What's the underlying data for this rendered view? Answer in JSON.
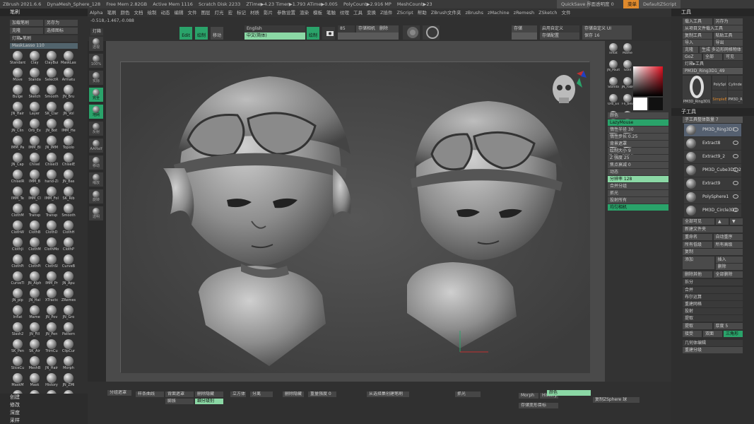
{
  "titlebar": {
    "app": "ZBrush 2021.6.6",
    "doc": "DynaMesh_Sphere_128",
    "free_mem": "Free Mem 2.82GB",
    "active_mem": "Active Mem 1116",
    "scratch": "Scratch Disk 2233",
    "ztime": "ZTime▶4.23 Timer▶1.793 ATime▶0.005",
    "polycount": "PolyCount▶2.916 MP",
    "meshcount": "MeshCount▶23",
    "quicksave": "QuickSave",
    "transparency": "界面透明度 0",
    "menu_btn": "菜单",
    "script": "DefaultZScript"
  },
  "menubar": [
    "Alpha",
    "笔刷",
    "颜色",
    "文档",
    "绘制",
    "动态",
    "编辑",
    "文件",
    "图层",
    "灯光",
    "宏",
    "标记",
    "材质",
    "影片",
    "参数设置",
    "渲染",
    "模板",
    "笔触",
    "纹理",
    "工具",
    "变换",
    "Z插件",
    "ZScript",
    "帮助",
    "ZBrush文件夹",
    "zBrushs",
    "zMachine",
    "zRemesh",
    "ZSketch",
    "文件"
  ],
  "left": {
    "header": "笔刷",
    "load": "加载笔刷",
    "saveas": "另存为",
    "clone": "克隆",
    "select_icon": "选择图标",
    "lightbox": "灯箱▸笔刷",
    "mask_slider": "MaskLasso  110",
    "brushes": [
      "Standard",
      "Clay",
      "ClayBui",
      "MaskLasso",
      "Move",
      "Standa",
      "SelectR",
      "Armatu",
      "Bulge",
      "Sketch",
      "Smooth",
      "JN_Bru",
      "JN_Hair",
      "Layer",
      "SK_Clar",
      "JN_Vol",
      "JN_Clin",
      "Orb_Ex",
      "JN_Bot",
      "IMM_He",
      "IMM_Pa",
      "IMM_Bi",
      "JN_IMM",
      "Topolo",
      "JN_Cap",
      "Chisel",
      "Chisel3",
      "ChiselE",
      "ChiselR",
      "IMM_B",
      "hand-Zi",
      "JN_Bas",
      "IMM_Te",
      "IMM_Cl",
      "IMM_Fol",
      "SK_Rib",
      "ClothM",
      "Transp",
      "Transp",
      "Smooth",
      "ClothW",
      "ClothB",
      "ClothD",
      "ClothH",
      "ClothJi",
      "ClothM",
      "ClothMo",
      "ClothP",
      "ClothPi",
      "ClothPi",
      "ClothSl",
      "CurveB",
      "CurveTi",
      "JN_Alph",
      "IMM_Pr",
      "JN_Apu",
      "JN_pip",
      "JN_Hai",
      "XTractc",
      "ZRemes",
      "Inflat",
      "Mame",
      "JN_Pov",
      "JN_Gro",
      "Slash2",
      "JN_Fill",
      "JN_Pen",
      "Pattern",
      "SK_Pen",
      "SK_Air",
      "TrimCu",
      "ClipCur",
      "SliceCu",
      "MeshB",
      "JN_Hair",
      "Morph",
      "MaskM",
      "Mask",
      "History",
      "JN_ZMi",
      "Smooth",
      "JN_Cla",
      "Danosi",
      "JN_Sna",
      "Move",
      "从选择集创建笔刷"
    ],
    "bottom_items": [
      "创建",
      "修改",
      "深度",
      "采样"
    ]
  },
  "toptool": {
    "lightbox": "灯箱",
    "coords": "-0.518,-1.467,-0.088",
    "edit": "Edit",
    "draw": "绘制",
    "move": "移动",
    "english": "English",
    "chinese": "中文(简体)",
    "z_intensity": "绘制",
    "save_cam": "存储相机",
    "delete": "删除",
    "store": "存储",
    "sym": "85",
    "custom_ui": "启用自定义",
    "save_custom": "存储自定义 UI",
    "store_config": "存储配置",
    "save_as": "保存 16"
  },
  "shelf": [
    "透视",
    "100%",
    "实际",
    "完全",
    "地网",
    "反射",
    "AAHalf",
    "移动",
    "缩放",
    "旋转",
    "透明"
  ],
  "rtray": {
    "mat_labels": [
      "Inflat",
      "Mame",
      "JN_Poult",
      "Gold",
      "Standa",
      "JN_Fabr",
      "Orb_Ex",
      "Fli_bev",
      "Zadd",
      "Zsub",
      "JN_Pen",
      "Pattern",
      "SK_Air",
      "TrimCu",
      "ClipCur",
      "SliceCu",
      "LazyMouse",
      "惰性半径",
      "Skin Shader",
      "Flat",
      "MatCap",
      "Dynamesh"
    ],
    "color_label": "颜色",
    "fill_label": "填充",
    "lazy": "LazyMouse",
    "radius": "惰性半径 30",
    "lazy_step": "惰性步长 0.25",
    "background": "背景遮罩",
    "draw_size": "绘制大小 9",
    "z_intensity": "Z 强度 25",
    "focal": "焦点衰减 0",
    "dynamic": "动态",
    "resolution": "分辨率 128",
    "merge": "合并分组",
    "polish": "抓光",
    "project": "投射所有",
    "zremesh": "均匀相机"
  },
  "right": {
    "header": "工具",
    "load": "载入工具",
    "saveas": "另存为",
    "copy_from": "从项目文件载入工具",
    "copy": "复制工具",
    "paste": "粘贴工具",
    "import": "导入",
    "export": "导出",
    "clone": "克隆",
    "make_polymesh": "生成 多边形网格物体",
    "goz": "GoZ",
    "all": "全部",
    "visible": "可见",
    "lightbox": "灯箱▸工具",
    "tool_name": "PM3D_Ring3D1_49",
    "tool_thumbs": [
      "PM3D_Ring3D1",
      "PolySpl",
      "Cylinde",
      "SimpleE",
      "PM3D_R"
    ],
    "subtool_header": "子工具",
    "subtool_count": "子工具整体数量 7",
    "subtools": [
      "PM3D_Ring3D1",
      "Extract8",
      "Extract9_2",
      "PM3D_Cube3D1_2",
      "Extract9",
      "PolySphere1",
      "PM3D_Circle3D1"
    ],
    "visibility": "全部可见",
    "new_folder": "新建文件夹",
    "rename": "重命名",
    "auto_reorder": "自动重序",
    "all_low": "所有低级",
    "all_high": "所有高级",
    "duplicate": "复制",
    "append": "添加",
    "insert": "插入",
    "delete": "删除",
    "del_others": "删除其他",
    "del_all": "全部删除",
    "split": "拆分",
    "merge": "合并",
    "boolean": "布尔运算",
    "remesh": "重建网格",
    "project": "投射",
    "extract": "提取",
    "thick": "厚度 5",
    "accept": "接受",
    "double": "双面",
    "tcorne": "三角形",
    "geometry": "几何体编辑",
    "reconstruct": "重建分级"
  },
  "bottom": {
    "groups": "分组遮罩",
    "spline": "样条曲线",
    "backface": "背面遮罩",
    "inflate": "膨胀",
    "rotate": "立方体",
    "delete_hidden": "删除隐藏",
    "del_hidden_label": "删除隐藏",
    "create_cube": "从选择集创建笔刷",
    "polish": "抓光",
    "morph": "Morph",
    "history": "History",
    "store_morph": "存储变形目标",
    "color": "颜色",
    "subdiv": "细分级别",
    "zsphere": "复制ZSphere 球",
    "weight": "重量强度 0",
    "xpose": "分离"
  },
  "colors": {
    "accent_orange": "#e08a2c",
    "accent_green": "#2aa36a",
    "light_green": "#8bd8a5",
    "viewport_bg": "#4a4a4a"
  },
  "viewport": {
    "model_count": 2
  }
}
